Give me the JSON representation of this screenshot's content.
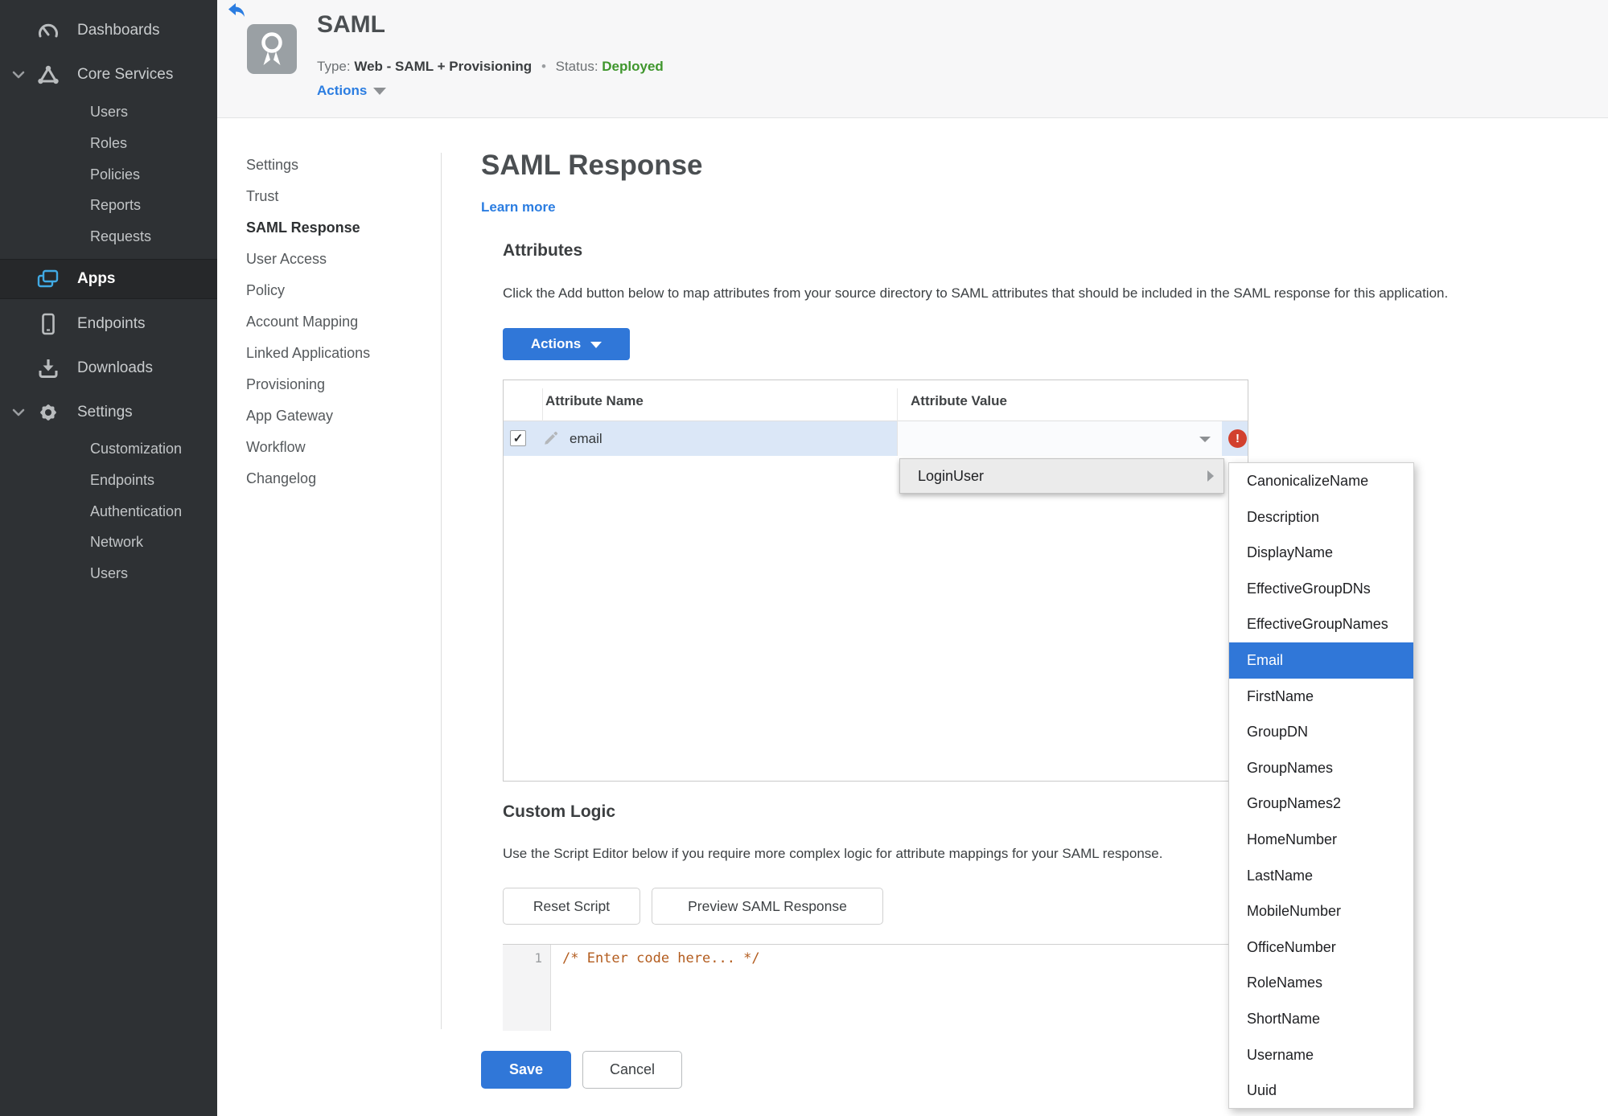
{
  "sidebar": {
    "dashboards": "Dashboards",
    "core_services": "Core Services",
    "core_children": [
      "Users",
      "Roles",
      "Policies",
      "Reports",
      "Requests"
    ],
    "apps": "Apps",
    "endpoints": "Endpoints",
    "downloads": "Downloads",
    "settings": "Settings",
    "settings_children": [
      "Customization",
      "Endpoints",
      "Authentication",
      "Network",
      "Users"
    ]
  },
  "header": {
    "app_title": "SAML",
    "type_label": "Type:",
    "type_value": "Web - SAML + Provisioning",
    "dot": "•",
    "status_label": "Status:",
    "status_value": "Deployed",
    "actions_label": "Actions"
  },
  "subnav": {
    "active": "SAML Response",
    "items": [
      "Settings",
      "Trust",
      "SAML Response",
      "User Access",
      "Policy",
      "Account Mapping",
      "Linked Applications",
      "Provisioning",
      "App Gateway",
      "Workflow",
      "Changelog"
    ]
  },
  "main": {
    "title": "SAML Response",
    "learn_more": "Learn more",
    "attributes": {
      "heading": "Attributes",
      "description": "Click the Add button below to map attributes from your source directory to SAML attributes that should be included in the SAML response for this application.",
      "actions_button": "Actions",
      "table": {
        "columns": [
          "Attribute Name",
          "Attribute Value"
        ],
        "rows": [
          {
            "name": "email",
            "value": "",
            "checked": true,
            "error": true
          }
        ]
      }
    },
    "value_menu": {
      "item": "LoginUser",
      "selected": "Email",
      "submenu": [
        "CanonicalizeName",
        "Description",
        "DisplayName",
        "EffectiveGroupDNs",
        "EffectiveGroupNames",
        "Email",
        "FirstName",
        "GroupDN",
        "GroupNames",
        "GroupNames2",
        "HomeNumber",
        "LastName",
        "MobileNumber",
        "OfficeNumber",
        "RoleNames",
        "ShortName",
        "Username",
        "Uuid"
      ]
    },
    "custom_logic": {
      "heading": "Custom Logic",
      "description": "Use the Script Editor below if you require more complex logic for attribute mappings for your SAML response.",
      "reset_button": "Reset Script",
      "preview_button": "Preview SAML Response",
      "editor": {
        "line_number": "1",
        "code": "/* Enter code here... */"
      }
    },
    "footer": {
      "save": "Save",
      "cancel": "Cancel"
    }
  },
  "icons": {
    "check": "✓",
    "error": "!"
  },
  "colors": {
    "accent_blue": "#3077d8",
    "link_blue": "#2b7de1",
    "status_green": "#3f962d",
    "error_red": "#d2402e",
    "row_highlight": "#dbe7f7",
    "sidebar_bg": "#2e3134",
    "code_comment": "#b35c1e"
  }
}
